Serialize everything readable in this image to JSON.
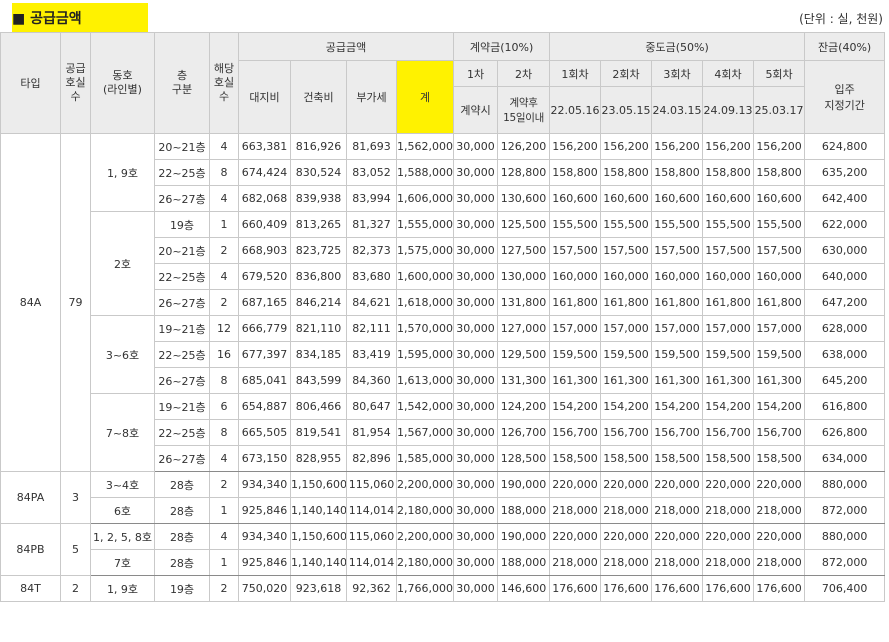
{
  "title": "■ 공급금액",
  "unit": "(단위 : 실, 천원)",
  "highlight_color": "#fff200",
  "header": {
    "type": "타입",
    "supply_units": "공급호실수",
    "supply_units_lines": [
      "공급",
      "호실",
      "수"
    ],
    "dong": "동호(라인별)",
    "dong_lines": [
      "동호",
      "(라인별)"
    ],
    "floor": "층구분",
    "floor_lines": [
      "층",
      "구분"
    ],
    "units": "해당호실수",
    "units_lines": [
      "해당",
      "호실",
      "수"
    ],
    "supply_amount": "공급금액",
    "land": "대지비",
    "building": "건축비",
    "vat": "부가세",
    "total": "계",
    "contract": "계약금(10%)",
    "c1": "1차",
    "c2": "2차",
    "c1_when": "계약시",
    "c2_when_lines": [
      "계약후",
      "15일이내"
    ],
    "middle": "중도금(50%)",
    "m1": "1회차",
    "m2": "2회차",
    "m3": "3회차",
    "m4": "4회차",
    "m5": "5회차",
    "m1_date": "22.05.16",
    "m2_date": "23.05.15",
    "m3_date": "24.03.15",
    "m4_date": "24.09.13",
    "m5_date": "25.03.17",
    "balance": "잔금(40%)",
    "balance_when_lines": [
      "입주",
      "지정기간"
    ]
  },
  "rows": [
    {
      "type": "84A",
      "supply": "79",
      "dong": "1, 9호",
      "floor": "20~21층",
      "units": "4",
      "land": "663,381",
      "building": "816,926",
      "vat": "81,693",
      "total": "1,562,000",
      "c1": "30,000",
      "c2": "126,200",
      "m": "156,200",
      "bal": "624,800"
    },
    {
      "floor": "22~25층",
      "units": "8",
      "land": "674,424",
      "building": "830,524",
      "vat": "83,052",
      "total": "1,588,000",
      "c1": "30,000",
      "c2": "128,800",
      "m": "158,800",
      "bal": "635,200"
    },
    {
      "floor": "26~27층",
      "units": "4",
      "land": "682,068",
      "building": "839,938",
      "vat": "83,994",
      "total": "1,606,000",
      "c1": "30,000",
      "c2": "130,600",
      "m": "160,600",
      "bal": "642,400"
    },
    {
      "dong": "2호",
      "floor": "19층",
      "units": "1",
      "land": "660,409",
      "building": "813,265",
      "vat": "81,327",
      "total": "1,555,000",
      "c1": "30,000",
      "c2": "125,500",
      "m": "155,500",
      "bal": "622,000"
    },
    {
      "floor": "20~21층",
      "units": "2",
      "land": "668,903",
      "building": "823,725",
      "vat": "82,373",
      "total": "1,575,000",
      "c1": "30,000",
      "c2": "127,500",
      "m": "157,500",
      "bal": "630,000"
    },
    {
      "floor": "22~25층",
      "units": "4",
      "land": "679,520",
      "building": "836,800",
      "vat": "83,680",
      "total": "1,600,000",
      "c1": "30,000",
      "c2": "130,000",
      "m": "160,000",
      "bal": "640,000"
    },
    {
      "floor": "26~27층",
      "units": "2",
      "land": "687,165",
      "building": "846,214",
      "vat": "84,621",
      "total": "1,618,000",
      "c1": "30,000",
      "c2": "131,800",
      "m": "161,800",
      "bal": "647,200"
    },
    {
      "dong": "3~6호",
      "floor": "19~21층",
      "units": "12",
      "land": "666,779",
      "building": "821,110",
      "vat": "82,111",
      "total": "1,570,000",
      "c1": "30,000",
      "c2": "127,000",
      "m": "157,000",
      "bal": "628,000"
    },
    {
      "floor": "22~25층",
      "units": "16",
      "land": "677,397",
      "building": "834,185",
      "vat": "83,419",
      "total": "1,595,000",
      "c1": "30,000",
      "c2": "129,500",
      "m": "159,500",
      "bal": "638,000"
    },
    {
      "floor": "26~27층",
      "units": "8",
      "land": "685,041",
      "building": "843,599",
      "vat": "84,360",
      "total": "1,613,000",
      "c1": "30,000",
      "c2": "131,300",
      "m": "161,300",
      "bal": "645,200"
    },
    {
      "dong": "7~8호",
      "floor": "19~21층",
      "units": "6",
      "land": "654,887",
      "building": "806,466",
      "vat": "80,647",
      "total": "1,542,000",
      "c1": "30,000",
      "c2": "124,200",
      "m": "154,200",
      "bal": "616,800"
    },
    {
      "floor": "22~25층",
      "units": "8",
      "land": "665,505",
      "building": "819,541",
      "vat": "81,954",
      "total": "1,567,000",
      "c1": "30,000",
      "c2": "126,700",
      "m": "156,700",
      "bal": "626,800"
    },
    {
      "floor": "26~27층",
      "units": "4",
      "land": "673,150",
      "building": "828,955",
      "vat": "82,896",
      "total": "1,585,000",
      "c1": "30,000",
      "c2": "128,500",
      "m": "158,500",
      "bal": "634,000"
    },
    {
      "type": "84PA",
      "supply": "3",
      "dong": "3~4호",
      "floor": "28층",
      "units": "2",
      "land": "934,340",
      "building": "1,150,600",
      "vat": "115,060",
      "total": "2,200,000",
      "c1": "30,000",
      "c2": "190,000",
      "m": "220,000",
      "bal": "880,000"
    },
    {
      "dong": "6호",
      "floor": "28층",
      "units": "1",
      "land": "925,846",
      "building": "1,140,140",
      "vat": "114,014",
      "total": "2,180,000",
      "c1": "30,000",
      "c2": "188,000",
      "m": "218,000",
      "bal": "872,000"
    },
    {
      "type": "84PB",
      "supply": "5",
      "dong": "1, 2, 5, 8호",
      "floor": "28층",
      "units": "4",
      "land": "934,340",
      "building": "1,150,600",
      "vat": "115,060",
      "total": "2,200,000",
      "c1": "30,000",
      "c2": "190,000",
      "m": "220,000",
      "bal": "880,000"
    },
    {
      "dong": "7호",
      "floor": "28층",
      "units": "1",
      "land": "925,846",
      "building": "1,140,140",
      "vat": "114,014",
      "total": "2,180,000",
      "c1": "30,000",
      "c2": "188,000",
      "m": "218,000",
      "bal": "872,000"
    },
    {
      "type": "84T",
      "supply": "2",
      "dong": "1, 9호",
      "floor": "19층",
      "units": "2",
      "land": "750,020",
      "building": "923,618",
      "vat": "92,362",
      "total": "1,766,000",
      "c1": "30,000",
      "c2": "146,600",
      "m": "176,600",
      "bal": "706,400"
    }
  ]
}
